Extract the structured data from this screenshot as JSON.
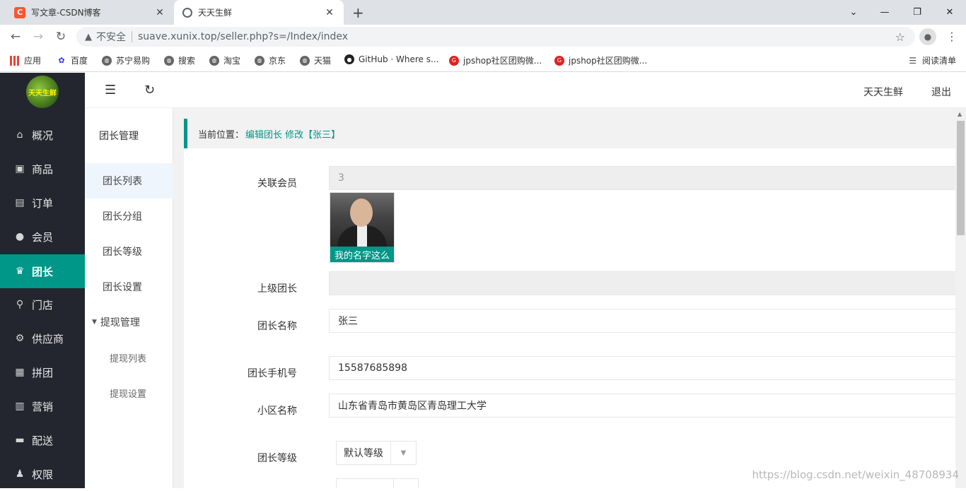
{
  "browser": {
    "tabs": [
      {
        "title": "写文章-CSDN博客",
        "favicon": "csdn-icon",
        "active": false
      },
      {
        "title": "天天生鲜",
        "favicon": "globe-icon",
        "active": true
      }
    ],
    "security_label": "不安全",
    "url": "suave.xunix.top/seller.php?s=/Index/index",
    "bookmarks": [
      {
        "label": "应用",
        "icon": "apps-grid-icon"
      },
      {
        "label": "百度",
        "icon": "baidu-paw-icon"
      },
      {
        "label": "苏宁易购",
        "icon": "globe-icon"
      },
      {
        "label": "搜索",
        "icon": "globe-icon"
      },
      {
        "label": "淘宝",
        "icon": "globe-icon"
      },
      {
        "label": "京东",
        "icon": "globe-icon"
      },
      {
        "label": "天猫",
        "icon": "globe-icon"
      },
      {
        "label": "GitHub · Where s...",
        "icon": "github-icon"
      },
      {
        "label": "jpshop社区团购微...",
        "icon": "jpshop-icon"
      },
      {
        "label": "jpshop社区团购微...",
        "icon": "jpshop-icon"
      }
    ],
    "reading_list": "阅读清单"
  },
  "sidebar": {
    "items": [
      {
        "label": "概况",
        "icon": "home-icon",
        "active": false
      },
      {
        "label": "商品",
        "icon": "goods-icon",
        "active": false
      },
      {
        "label": "订单",
        "icon": "order-icon",
        "active": false
      },
      {
        "label": "会员",
        "icon": "user-icon",
        "active": false
      },
      {
        "label": "团长",
        "icon": "crown-icon",
        "active": true
      },
      {
        "label": "门店",
        "icon": "store-icon",
        "active": false
      },
      {
        "label": "供应商",
        "icon": "supplier-icon",
        "active": false
      },
      {
        "label": "拼团",
        "icon": "group-buy-icon",
        "active": false
      },
      {
        "label": "营销",
        "icon": "gift-icon",
        "active": false
      },
      {
        "label": "配送",
        "icon": "truck-icon",
        "active": false
      },
      {
        "label": "权限",
        "icon": "permission-icon",
        "active": false
      }
    ]
  },
  "topbar": {
    "shop_name": "天天生鲜",
    "logout": "退出"
  },
  "subnav": {
    "header": "团长管理",
    "items": [
      {
        "label": "团长列表",
        "active": true
      },
      {
        "label": "团长分组",
        "active": false
      },
      {
        "label": "团长等级",
        "active": false
      },
      {
        "label": "团长设置",
        "active": false
      }
    ],
    "group": {
      "label": "提现管理",
      "items": [
        "提现列表",
        "提现设置"
      ]
    }
  },
  "breadcrumb": {
    "label": "当前位置：",
    "path": "编辑团长 修改【张三】"
  },
  "form": {
    "member": {
      "label": "关联会员",
      "value": "3",
      "avatar_caption": "我的名字这么"
    },
    "parent": {
      "label": "上级团长",
      "value": ""
    },
    "name": {
      "label": "团长名称",
      "value": "张三"
    },
    "phone": {
      "label": "团长手机号",
      "value": "15587685898"
    },
    "community": {
      "label": "小区名称",
      "value": "山东省青岛市黄岛区青岛理工大学"
    },
    "level": {
      "label": "团长等级",
      "value": "默认等级"
    }
  },
  "watermark": "https://blog.csdn.net/weixin_48708934",
  "colors": {
    "accent": "#009688",
    "sidebar_bg": "#23262e"
  }
}
